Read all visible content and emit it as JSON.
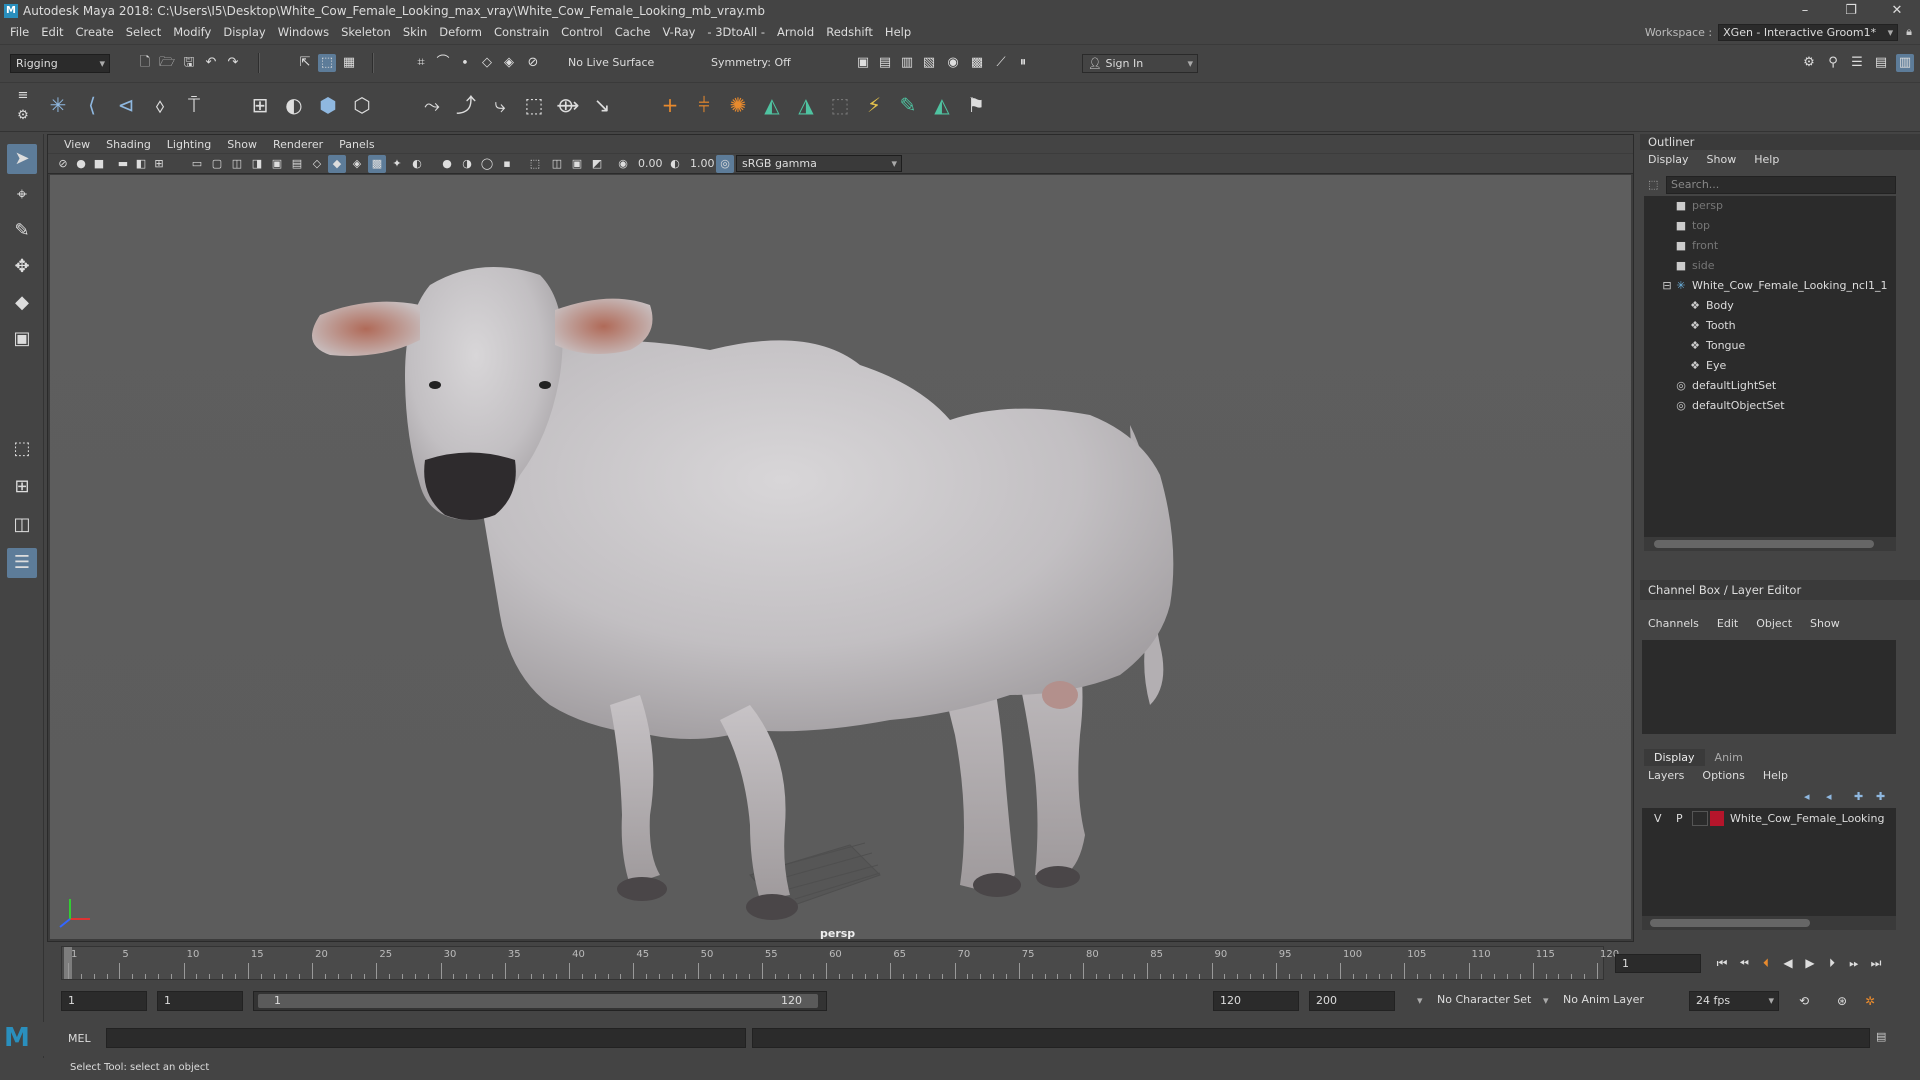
{
  "window": {
    "title": "Autodesk Maya 2018: C:\\Users\\I5\\Desktop\\White_Cow_Female_Looking_max_vray\\White_Cow_Female_Looking_mb_vray.mb",
    "app_icon": "M",
    "minimize": "–",
    "restore": "❐",
    "close": "✕"
  },
  "menubar": {
    "items": [
      "File",
      "Edit",
      "Create",
      "Select",
      "Modify",
      "Display",
      "Windows",
      "Skeleton",
      "Skin",
      "Deform",
      "Constrain",
      "Control",
      "Cache",
      "V-Ray",
      "- 3DtoAll -",
      "Arnold",
      "Redshift",
      "Help"
    ],
    "workspace_label": "Workspace :",
    "workspace_value": "XGen - Interactive Groom1*"
  },
  "statusline": {
    "mode": "Rigging",
    "live_surface": "No Live Surface",
    "symmetry": "Symmetry: Off",
    "sign_in": "Sign In"
  },
  "viewport": {
    "menus": [
      "View",
      "Shading",
      "Lighting",
      "Show",
      "Renderer",
      "Panels"
    ],
    "exposure": "0.00",
    "gamma": "1.00",
    "color_space": "sRGB gamma",
    "camera_label": "persp"
  },
  "outliner": {
    "title": "Outliner",
    "menus": [
      "Display",
      "Show",
      "Help"
    ],
    "search_placeholder": "Search...",
    "items": [
      {
        "label": "persp",
        "icon": "camera-icon",
        "dim": true
      },
      {
        "label": "top",
        "icon": "camera-icon",
        "dim": true
      },
      {
        "label": "front",
        "icon": "camera-icon",
        "dim": true
      },
      {
        "label": "side",
        "icon": "camera-icon",
        "dim": true
      },
      {
        "label": "White_Cow_Female_Looking_ncl1_1",
        "icon": "joint-icon",
        "dim": false
      },
      {
        "label": "Body",
        "icon": "mesh-icon",
        "dim": false
      },
      {
        "label": "Tooth",
        "icon": "mesh-icon",
        "dim": false
      },
      {
        "label": "Tongue",
        "icon": "mesh-icon",
        "dim": false
      },
      {
        "label": "Eye",
        "icon": "mesh-icon",
        "dim": false
      },
      {
        "label": "defaultLightSet",
        "icon": "set-icon",
        "dim": false
      },
      {
        "label": "defaultObjectSet",
        "icon": "set-icon",
        "dim": false
      }
    ]
  },
  "channelbox": {
    "title": "Channel Box / Layer Editor",
    "menus": [
      "Channels",
      "Edit",
      "Object",
      "Show"
    ]
  },
  "layereditor": {
    "tabs": [
      "Display",
      "Anim"
    ],
    "menus": [
      "Layers",
      "Options",
      "Help"
    ],
    "layer": {
      "v": "V",
      "p": "P",
      "name": "White_Cow_Female_Looking",
      "color": "#b5152b"
    }
  },
  "timeline": {
    "ticks": [
      "1",
      "5",
      "10",
      "15",
      "20",
      "25",
      "30",
      "35",
      "40",
      "45",
      "50",
      "55",
      "60",
      "65",
      "70",
      "75",
      "80",
      "85",
      "90",
      "95",
      "100",
      "105",
      "110",
      "115",
      "120"
    ],
    "current_frame": "1"
  },
  "range": {
    "start": "1",
    "playback_start": "1",
    "slider_start": "1",
    "slider_end": "120",
    "playback_end": "120",
    "end": "200",
    "character_set": "No Character Set",
    "anim_layer": "No Anim Layer",
    "fps": "24 fps"
  },
  "command": {
    "label": "MEL",
    "help_text": "Select Tool: select an object"
  },
  "colors": {
    "select_blue": "#5d7c99",
    "layer_red": "#b5152b"
  }
}
